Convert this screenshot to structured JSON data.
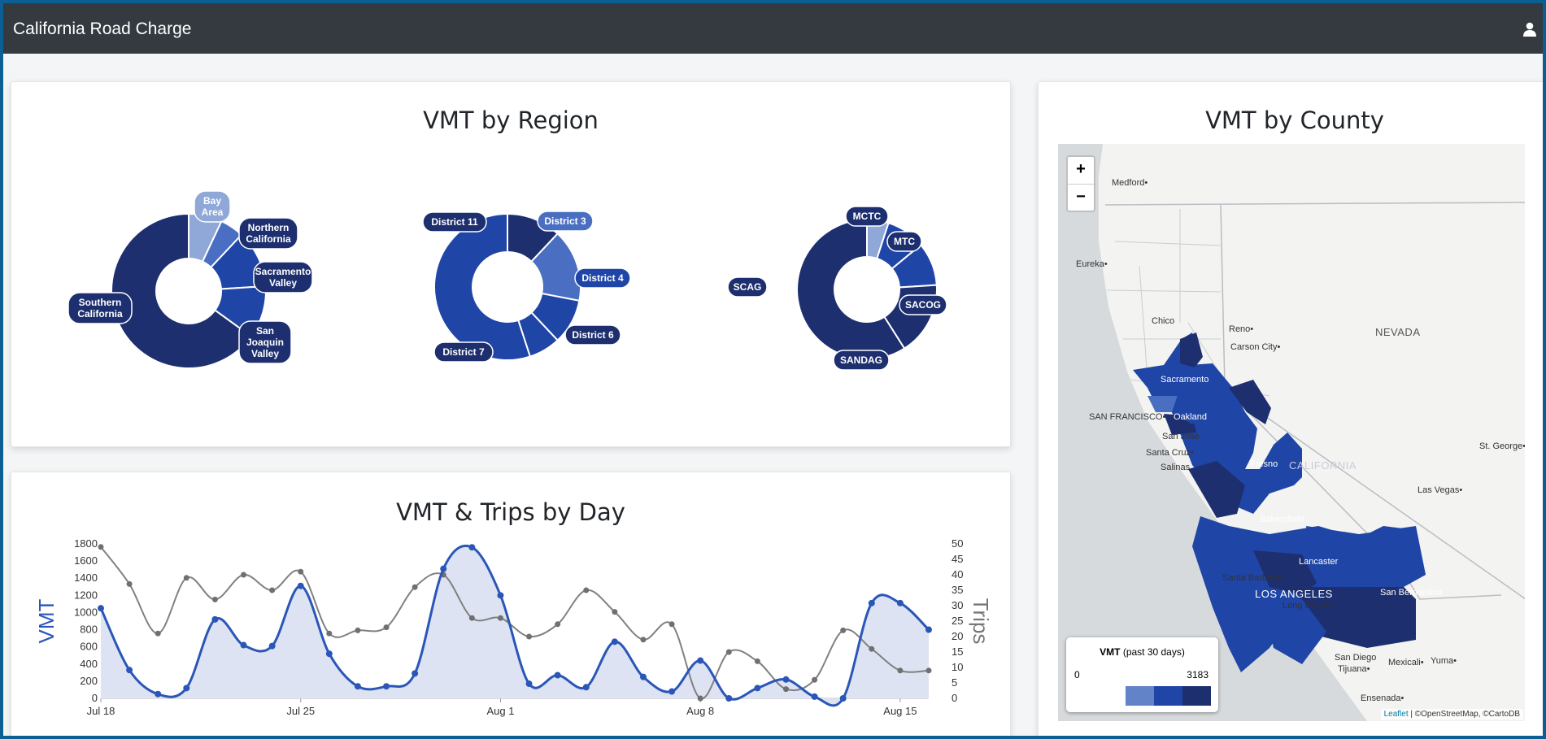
{
  "app": {
    "title": "California Road Charge"
  },
  "colors": {
    "dark": "#1d2f6f",
    "mid": "#1f45a6",
    "light": "#4a6fc2",
    "pale": "#8fa8d8"
  },
  "region_card": {
    "title": "VMT by Region",
    "donut1": {
      "labels": {
        "bay": "Bay Area",
        "northern": "Northern California",
        "sacramento": "Sacramento Valley",
        "san_joaquin": "San Joaquin Valley",
        "southern": "Southern California"
      }
    },
    "donut2": {
      "labels": {
        "d11": "District 11",
        "d3": "District 3",
        "d4": "District 4",
        "d6": "District 6",
        "d7": "District 7"
      }
    },
    "donut3": {
      "labels": {
        "mctc": "MCTC",
        "mtc": "MTC",
        "sacog": "SACOG",
        "sandag": "SANDAG",
        "scag": "SCAG"
      }
    }
  },
  "day_card": {
    "title": "VMT & Trips by Day"
  },
  "county_card": {
    "title": "VMT by County",
    "zoom_in": "+",
    "zoom_out": "−",
    "legend": {
      "title_bold": "VMT",
      "title_rest": " (past 30 days)",
      "min": "0",
      "max": "3183"
    },
    "attribution": {
      "leaflet": "Leaflet",
      "rest": " | ©OpenStreetMap, ©CartoDB"
    },
    "places": {
      "medford": "Medford•",
      "eureka": "Eureka•",
      "chico": "Chico",
      "reno": "Reno•",
      "carson": "Carson City•",
      "nevada": "NEVADA",
      "sacramento": "Sacramento",
      "sf": "SAN FRANCISCO•",
      "oakland": "Oakland",
      "sanjose": "San Jose",
      "santacruz": "Santa Cruz•",
      "salinas": "Salinas",
      "fresno": "Fresno",
      "california": "CALIFORNIA",
      "stgeorge": "St. George•",
      "lasvegas": "Las Vegas•",
      "bakersfield": "Bakersfield",
      "santabarbara": "Santa Barbara•",
      "lancaster": "Lancaster",
      "la": "LOS ANGELES",
      "sanbern": "San Bernardino",
      "longbeach": "Long Beach•",
      "sandiego": "San Diego",
      "tijuana": "Tijuana•",
      "mexicali": "Mexicali•",
      "yuma": "Yuma•",
      "ensenada": "Ensenada•"
    }
  },
  "chart_data": [
    {
      "type": "pie",
      "title": "VMT by Region",
      "categories": [
        "Bay Area",
        "Northern California",
        "Sacramento Valley",
        "San Joaquin Valley",
        "Southern California"
      ],
      "values": [
        7,
        5,
        12,
        11,
        65
      ]
    },
    {
      "type": "pie",
      "categories": [
        "District 11",
        "District 3",
        "District 4",
        "District 6",
        "District 7"
      ],
      "values": [
        12,
        16,
        10,
        7,
        55
      ]
    },
    {
      "type": "pie",
      "categories": [
        "MCTC",
        "MTC",
        "SACOG",
        "SANDAG",
        "SCAG"
      ],
      "values": [
        5,
        9,
        10,
        17,
        59
      ]
    },
    {
      "type": "line",
      "title": "VMT & Trips by Day",
      "x": [
        "Jul 18",
        "Jul 19",
        "Jul 20",
        "Jul 21",
        "Jul 22",
        "Jul 23",
        "Jul 24",
        "Jul 25",
        "Jul 26",
        "Jul 27",
        "Jul 28",
        "Jul 29",
        "Jul 30",
        "Jul 31",
        "Aug 1",
        "Aug 2",
        "Aug 3",
        "Aug 4",
        "Aug 5",
        "Aug 6",
        "Aug 7",
        "Aug 8",
        "Aug 9",
        "Aug 10",
        "Aug 11",
        "Aug 12",
        "Aug 13",
        "Aug 14",
        "Aug 15",
        "Aug 16"
      ],
      "x_ticks": [
        "Jul 18",
        "Jul 25",
        "Aug 1",
        "Aug 8",
        "Aug 15"
      ],
      "ylabel": "VMT",
      "y2label": "Trips",
      "ylim": [
        0,
        1800
      ],
      "y2lim": [
        0,
        50
      ],
      "y_ticks": [
        0,
        200,
        400,
        600,
        800,
        1000,
        1200,
        1400,
        1600,
        1800
      ],
      "y2_ticks": [
        0,
        5,
        10,
        15,
        20,
        25,
        30,
        35,
        40,
        45,
        50
      ],
      "series": [
        {
          "axis": "left",
          "values": [
            1050,
            330,
            50,
            120,
            920,
            620,
            610,
            1310,
            520,
            140,
            140,
            290,
            1510,
            1760,
            1200,
            170,
            270,
            130,
            660,
            250,
            80,
            440,
            0,
            120,
            220,
            20,
            0,
            1110,
            1110,
            800
          ]
        },
        {
          "axis": "right",
          "values": [
            49,
            37,
            21,
            39,
            32,
            40,
            35,
            41,
            21,
            22,
            23,
            36,
            40,
            26,
            26,
            20,
            24,
            35,
            28,
            19,
            24,
            0,
            15,
            12,
            3,
            6,
            22,
            16,
            9,
            9
          ]
        }
      ]
    }
  ]
}
